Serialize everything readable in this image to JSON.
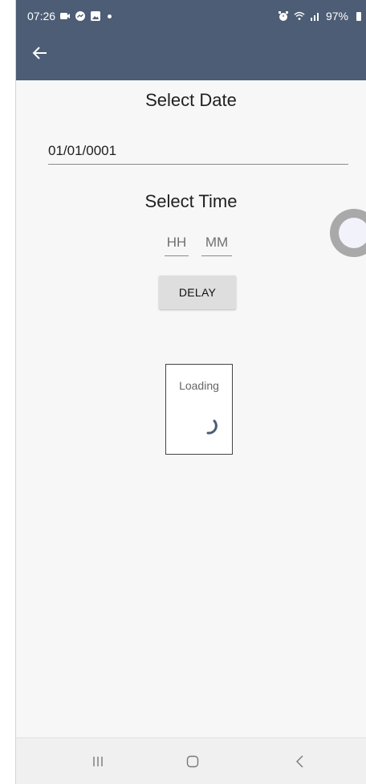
{
  "status_bar": {
    "time": "07:26",
    "battery": "97%",
    "left_icons": [
      "screen-record-icon",
      "messenger-icon",
      "gallery-icon"
    ],
    "right_icons": [
      "alarm-icon",
      "wifi-icon",
      "signal-icon",
      "battery-icon"
    ]
  },
  "app_bar": {
    "back_icon": "arrow-left-icon",
    "color": "#4c5d75"
  },
  "date_section": {
    "heading": "Select Date",
    "value": "01/01/0001"
  },
  "time_section": {
    "heading": "Select Time",
    "hour_placeholder": "HH",
    "minute_placeholder": "MM"
  },
  "delay_button": {
    "label": "DELAY"
  },
  "loading": {
    "label": "Loading",
    "spinner_color": "#4c5d75"
  },
  "nav_bar": {
    "recents_icon": "recents-icon",
    "home_icon": "home-icon",
    "back_icon": "back-icon"
  }
}
